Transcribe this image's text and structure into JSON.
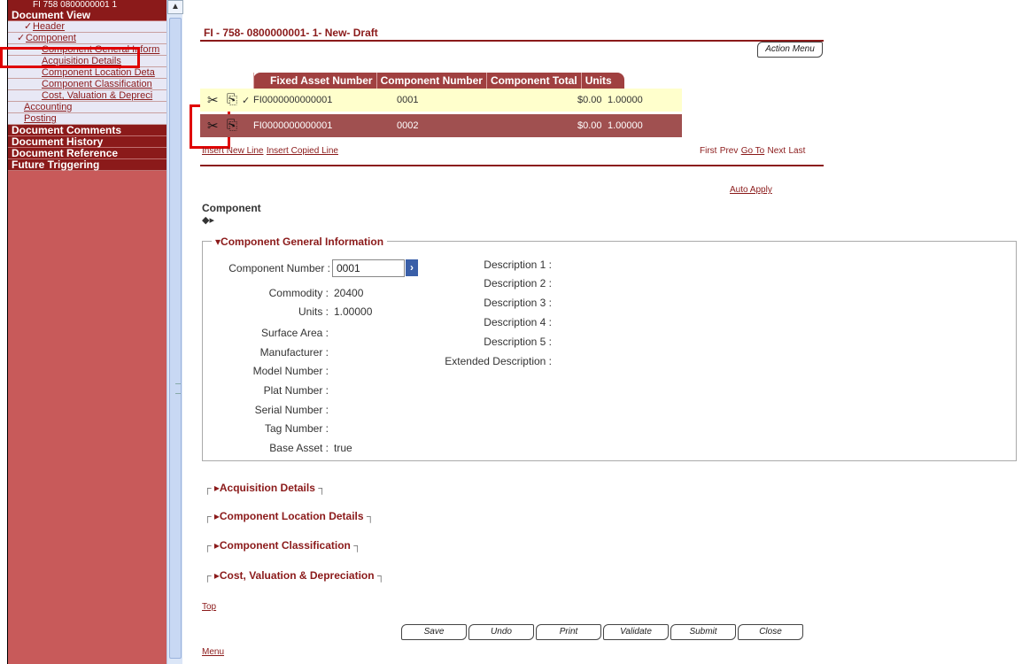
{
  "sidebar": {
    "title": "FI 758 0800000001 1",
    "sections": {
      "document_view": "Document View",
      "document_comments": "Document Comments",
      "document_history": "Document History",
      "document_reference": "Document Reference",
      "future_triggering": "Future Triggering"
    },
    "items": {
      "header": "Header",
      "component": "Component",
      "comp_general": "Component General Inform",
      "acquisition": "Acquisition Details",
      "location": "Component Location Deta",
      "classification": "Component Classification",
      "cost": "Cost, Valuation & Depreci",
      "accounting": "Accounting",
      "posting": "Posting"
    },
    "check_mark": "✓"
  },
  "header": {
    "doc_title": "FI - 758- 0800000001- 1- New- Draft",
    "action_menu": "Action Menu"
  },
  "grid": {
    "columns": [
      "Fixed Asset Number",
      "Component Number",
      "Component Total",
      "Units"
    ],
    "rows": [
      {
        "asset": "FI0000000000001",
        "component": "0001",
        "total": "$0.00",
        "units": "1.00000",
        "selected": "✓"
      },
      {
        "asset": "FI0000000000001",
        "component": "0002",
        "total": "$0.00",
        "units": "1.00000",
        "selected": ""
      }
    ],
    "insert_new_line": "Insert New Line",
    "insert_copied_line": "Insert Copied Line",
    "paging": {
      "first": "First",
      "prev": "Prev",
      "goto": "Go To",
      "next": "Next",
      "last": "Last"
    },
    "auto_apply": "Auto Apply"
  },
  "component": {
    "heading": "Component",
    "general_legend": "Component General Information",
    "fields_left": [
      {
        "label": "Commodity :",
        "value": "20400"
      },
      {
        "label": "Units :",
        "value": "1.00000"
      },
      {
        "label": "Surface Area :",
        "value": ""
      },
      {
        "label": "Manufacturer :",
        "value": ""
      },
      {
        "label": "Model Number :",
        "value": ""
      },
      {
        "label": "Plat Number :",
        "value": ""
      },
      {
        "label": "Serial Number :",
        "value": ""
      },
      {
        "label": "Tag Number :",
        "value": ""
      },
      {
        "label": "Base Asset :",
        "value": "true"
      }
    ],
    "component_number_label": "Component Number :",
    "component_number_value": "0001",
    "fields_right": [
      "Description 1 :",
      "Description 2 :",
      "Description 3 :",
      "Description 4 :",
      "Description 5 :",
      "Extended Description :"
    ],
    "collapsed_sections": [
      "Acquisition Details",
      "Component Location Details",
      "Component Classification",
      "Cost, Valuation & Depreciation"
    ]
  },
  "footer": {
    "top_link": "Top",
    "menu_link": "Menu",
    "buttons": {
      "save": "Save",
      "undo": "Undo",
      "print": "Print",
      "validate": "Validate",
      "submit": "Submit",
      "close": "Close"
    }
  },
  "colors": {
    "brand": "#8b1a1a",
    "sidebar": "#c85a5a",
    "highlight": "#e00000"
  }
}
